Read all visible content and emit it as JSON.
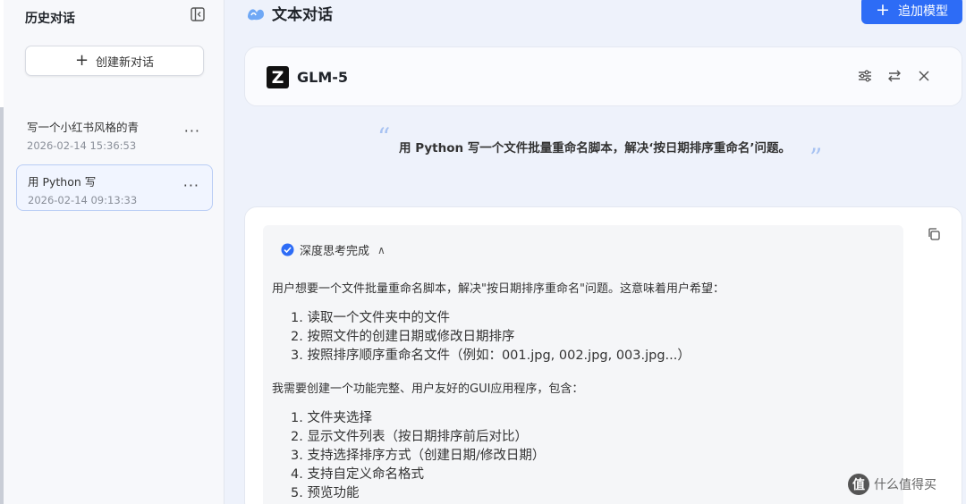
{
  "sidebar": {
    "title": "历史对话",
    "new_chat_label": "创建新对话",
    "items": [
      {
        "title": "写一个小红书风格的青",
        "time": "2026-02-14 15:36:53",
        "selected": false
      },
      {
        "title": "用 Python 写",
        "time": "2026-02-14 09:13:33",
        "selected": true
      }
    ],
    "more_label": "···"
  },
  "header": {
    "title": "文本对话",
    "add_model_label": "追加模型"
  },
  "model_card": {
    "logo_letter": "Z",
    "name": "GLM-5"
  },
  "question": "用 Python 写一个文件批量重命名脚本，解决‘按日期排序重命名’问题。",
  "answer": {
    "think_status": "深度思考完成",
    "intro": "用户想要一个文件批量重命名脚本，解决\"按日期排序重命名\"问题。这意味着用户希望：",
    "list1": [
      "1. 读取一个文件夹中的文件",
      "2. 按照文件的创建日期或修改日期排序",
      "3. 按照排序顺序重命名文件（例如：001.jpg, 002.jpg, 003.jpg...）"
    ],
    "mid": "我需要创建一个功能完整、用户友好的GUI应用程序，包含：",
    "list2": [
      "1. 文件夹选择",
      "2. 显示文件列表（按日期排序前后对比）",
      "3. 支持选择排序方式（创建日期/修改日期）",
      "4. 支持自定义命名格式",
      "5. 预览功能"
    ]
  },
  "watermark": {
    "logo_char": "值",
    "text": "什么值得买"
  },
  "colors": {
    "accent": "#2d6cf6",
    "selected_border": "#b9cdf5",
    "quote": "#a8c3f2"
  }
}
